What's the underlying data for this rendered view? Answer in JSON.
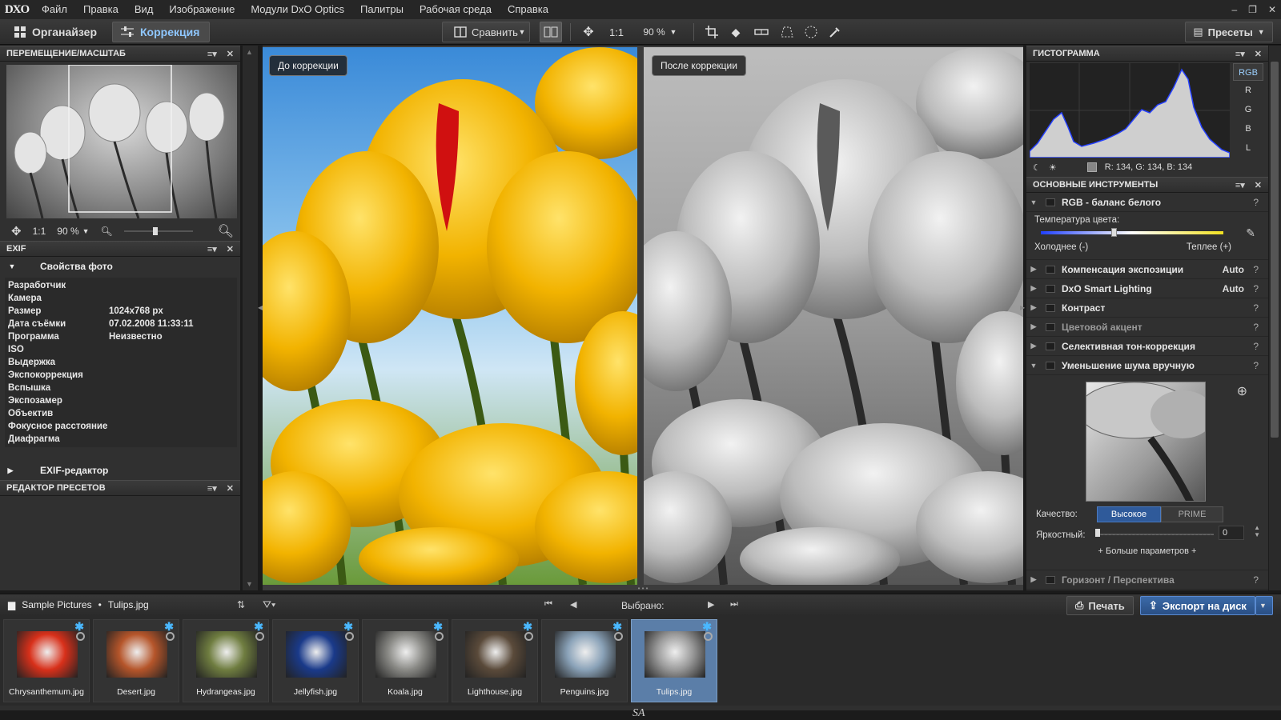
{
  "app": {
    "logo": "DXO"
  },
  "menu": [
    "Файл",
    "Правка",
    "Вид",
    "Изображение",
    "Модули DxO Optics",
    "Палитры",
    "Рабочая среда",
    "Справка"
  ],
  "window_controls": [
    "–",
    "❐",
    "✕"
  ],
  "toolbar": {
    "organizer": "Органайзер",
    "correction": "Коррекция",
    "compare": "Сравнить",
    "zoom_1to1": "1:1",
    "zoom_level": "90 %",
    "presets": "Пресеты"
  },
  "left": {
    "navigator_title": "ПЕРЕМЕЩЕНИЕ/МАСШТАБ",
    "nav_zoom_1to1": "1:1",
    "nav_zoom_level": "90 %",
    "nav_zoom_slider": 0.45,
    "exif_title": "EXIF",
    "exif_section": "Свойства фото",
    "exif_rows": [
      {
        "k": "Разработчик",
        "v": ""
      },
      {
        "k": "Камера",
        "v": ""
      },
      {
        "k": "Размер",
        "v": "1024x768 px"
      },
      {
        "k": "Дата съёмки",
        "v": "07.02.2008 11:33:11"
      },
      {
        "k": "Программа",
        "v": "Неизвестно"
      },
      {
        "k": "ISO",
        "v": ""
      },
      {
        "k": "Выдержка",
        "v": ""
      },
      {
        "k": "Экспокоррекция",
        "v": ""
      },
      {
        "k": "Вспышка",
        "v": ""
      },
      {
        "k": "Экспозамер",
        "v": ""
      },
      {
        "k": "Объектив",
        "v": ""
      },
      {
        "k": "Фокусное расстояние",
        "v": ""
      },
      {
        "k": "Диафрагма",
        "v": ""
      }
    ],
    "exif_editor": "EXIF-редактор",
    "preset_editor_title": "РЕДАКТОР ПРЕСЕТОВ"
  },
  "viewer": {
    "before_label": "До коррекции",
    "after_label": "После коррекции"
  },
  "right": {
    "histogram_title": "ГИСТОГРАММА",
    "channels": [
      "RGB",
      "R",
      "G",
      "B",
      "L"
    ],
    "pixel_readout": "R: 134, G: 134, B: 134",
    "tools_title": "ОСНОВНЫЕ ИНСТРУМЕНТЫ",
    "wb_title": "RGB - баланс белого",
    "color_temp": "Температура цвета:",
    "colder": "Холоднее (-)",
    "warmer": "Теплее (+)",
    "color_temp_slider": 0.4,
    "tools": [
      {
        "name": "Компенсация экспозиции",
        "auto": "Auto",
        "disabled": false
      },
      {
        "name": "DxO Smart Lighting",
        "auto": "Auto",
        "disabled": false
      },
      {
        "name": "Контраст",
        "auto": "",
        "disabled": false
      },
      {
        "name": "Цветовой акцент",
        "auto": "",
        "disabled": true
      },
      {
        "name": "Селективная тон-коррекция",
        "auto": "",
        "disabled": false
      }
    ],
    "noise_title": "Уменьшение шума вручную",
    "quality_label": "Качество:",
    "quality_high": "Высокое",
    "quality_prime": "PRIME",
    "luminance_label": "Яркостный:",
    "luminance_value": "0",
    "more_params": "+ Больше параметров +",
    "horizon": "Горизонт / Перспектива",
    "help": "?"
  },
  "filmbar": {
    "folder": "Sample Pictures",
    "separator": "•",
    "file": "Tulips.jpg",
    "sort_label": "⇅",
    "selected": "Выбрано:",
    "print": "Печать",
    "export": "Экспорт на диск"
  },
  "thumbnails": [
    {
      "name": "Chrysanthemum.jpg",
      "color": "#d8301a"
    },
    {
      "name": "Desert.jpg",
      "color": "#b5552a"
    },
    {
      "name": "Hydrangeas.jpg",
      "color": "#6f7d40"
    },
    {
      "name": "Jellyfish.jpg",
      "color": "#1a3a8a"
    },
    {
      "name": "Koala.jpg",
      "color": "#8a8a86"
    },
    {
      "name": "Lighthouse.jpg",
      "color": "#5a4a3a"
    },
    {
      "name": "Penguins.jpg",
      "color": "#8aa2b8"
    },
    {
      "name": "Tulips.jpg",
      "color": "#9a9a9a"
    }
  ],
  "watermark": "SA"
}
